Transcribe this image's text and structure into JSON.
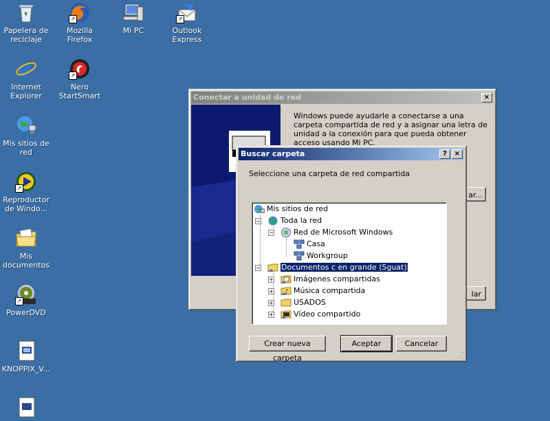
{
  "desktop": {
    "icons": [
      {
        "label": "Papelera de reciclaje",
        "icon": "recycle-bin-icon"
      },
      {
        "label": "Mozilla Firefox",
        "icon": "firefox-icon"
      },
      {
        "label": "Mi PC",
        "icon": "my-computer-icon"
      },
      {
        "label": "Outlook Express",
        "icon": "outlook-express-icon"
      },
      {
        "label": "Internet Explorer",
        "icon": "internet-explorer-icon"
      },
      {
        "label": "Nero StartSmart",
        "icon": "nero-icon"
      },
      {
        "label": "Mis sitios de red",
        "icon": "network-places-icon"
      },
      {
        "label": "Reproductor de Windo...",
        "icon": "media-player-icon"
      },
      {
        "label": "Mis documentos",
        "icon": "my-documents-icon"
      },
      {
        "label": "PowerDVD",
        "icon": "powerdvd-icon"
      },
      {
        "label": "KNOPPIX_V...",
        "icon": "file-icon"
      }
    ]
  },
  "map_drive_window": {
    "title": "Conectar a unidad de red",
    "description": "Windows puede ayudarle a conectarse a una carpeta compartida de red y a asignar una letra de unidad a la conexión para que pueda obtener acceso usando Mi PC.",
    "browse_label_partial": "ar...",
    "cancel_label_partial": "lar"
  },
  "browse_dialog": {
    "title": "Buscar carpeta",
    "help_button": "?",
    "close_button": "×",
    "prompt": "Seleccione una carpeta de red compartida",
    "tree": [
      {
        "label": "Mis sitios de red",
        "icon": "network-places-icon"
      },
      {
        "label": "Toda la red",
        "icon": "globe-icon"
      },
      {
        "label": "Red de Microsoft Windows",
        "icon": "windows-network-icon"
      },
      {
        "label": "Casa",
        "icon": "workgroup-icon"
      },
      {
        "label": "Workgroup",
        "icon": "workgroup-icon"
      },
      {
        "label": "Documentos c en grande (Sguat)",
        "icon": "shared-folder-icon"
      },
      {
        "label": "Imágenes compartidas",
        "icon": "pictures-folder-icon"
      },
      {
        "label": "Música compartida",
        "icon": "music-folder-icon"
      },
      {
        "label": "USADOS",
        "icon": "folder-icon"
      },
      {
        "label": "Vídeo compartido",
        "icon": "video-folder-icon"
      }
    ],
    "new_folder_button": "Crear nueva carpeta",
    "ok_button": "Aceptar",
    "cancel_button": "Cancelar"
  }
}
